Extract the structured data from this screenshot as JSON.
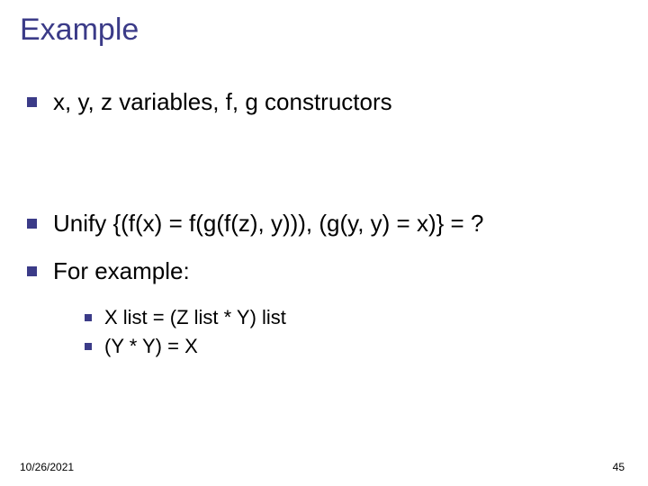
{
  "title": "Example",
  "items": [
    "x, y, z variables, f, g constructors",
    "Unify {(f(x) = f(g(f(z), y))), (g(y, y) = x)} = ?",
    "For example:"
  ],
  "subitems": [
    "X list = (Z list * Y) list",
    "(Y * Y) = X"
  ],
  "footer": {
    "date": "10/26/2021",
    "page": "45"
  }
}
